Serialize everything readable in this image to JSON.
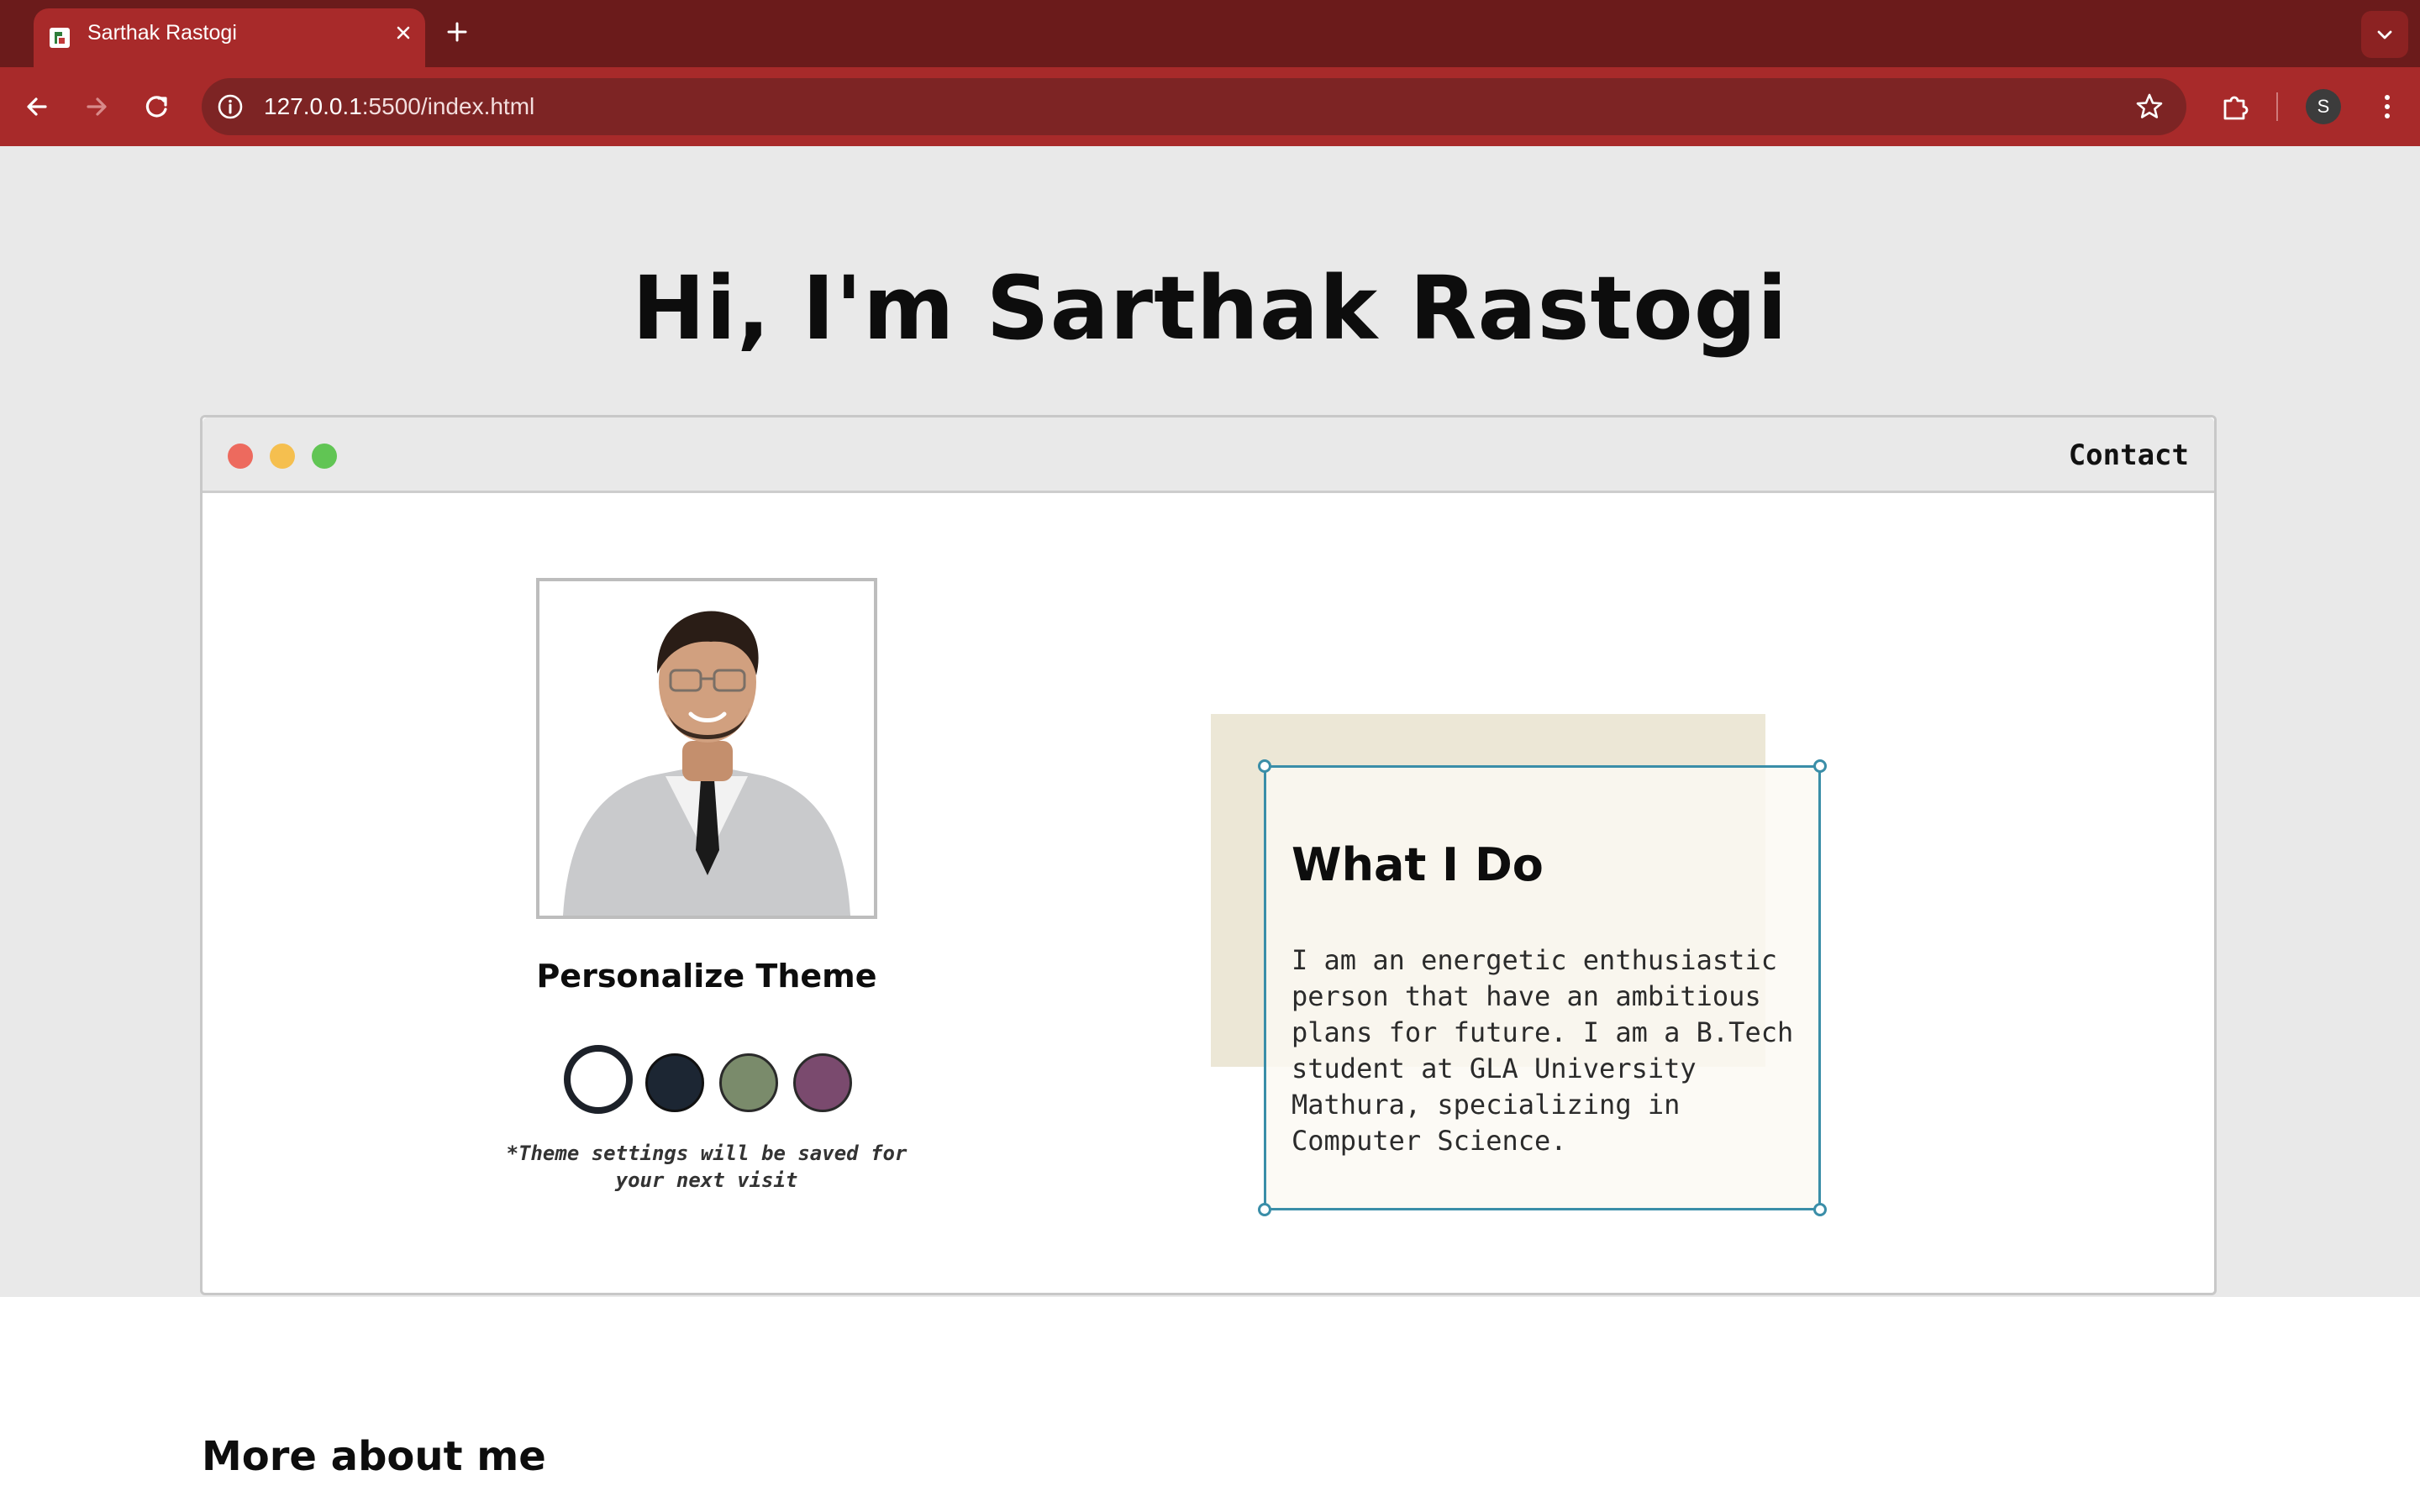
{
  "browser": {
    "tab_title": "Sarthak Rastogi",
    "url_host": "127.0.0.1",
    "url_rest": ":5500/index.html",
    "profile_initial": "S",
    "colors": {
      "tabbar": "#6b1b1b",
      "toolbar": "#a82a2a",
      "omnibox": "#7d2424"
    }
  },
  "page": {
    "hero_title": "Hi, I'm Sarthak Rastogi",
    "window": {
      "contact_label": "Contact",
      "traffic_lights": [
        "#ed6a5e",
        "#f5bf4f",
        "#61c554"
      ]
    },
    "profile": {
      "photo_alt": "Sarthak Rastogi",
      "theme_title": "Personalize Theme",
      "theme_swatches": [
        {
          "name": "light",
          "color": "#ffffff",
          "selected": true
        },
        {
          "name": "dark-navy",
          "color": "#1c2633",
          "selected": false
        },
        {
          "name": "sage-green",
          "color": "#7a8b6b",
          "selected": false
        },
        {
          "name": "plum",
          "color": "#7a4a6e",
          "selected": false
        }
      ],
      "theme_note": "*Theme settings will be saved for your next visit"
    },
    "what_i_do": {
      "title": "What I Do",
      "body": "I am an energetic enthusiastic person that have an ambitious plans for future. I am a B.Tech student at GLA University Mathura, specializing in Computer Science."
    },
    "more_about_title": "More about me"
  }
}
